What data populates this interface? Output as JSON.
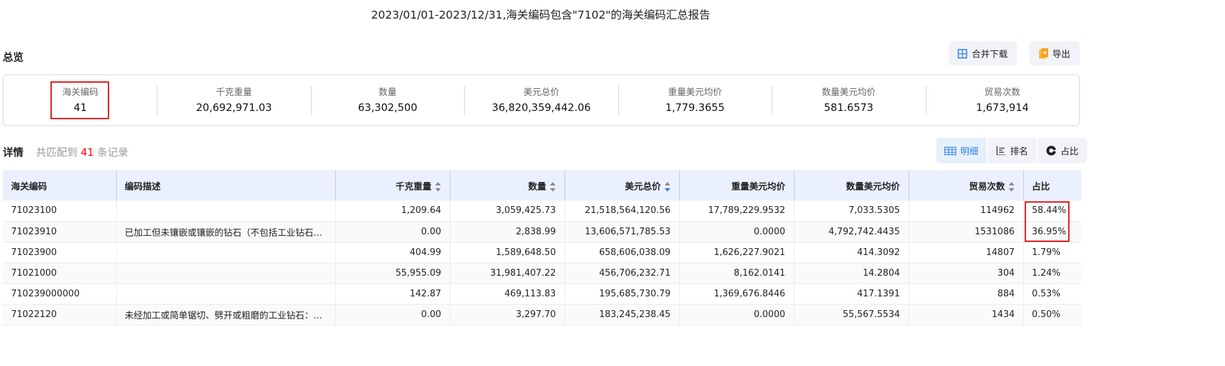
{
  "title": "2023/01/01-2023/12/31,海关编码包含\"7102\"的海关编码汇总报告",
  "overview": {
    "heading": "总览",
    "merge_download": "合并下载",
    "export": "导出",
    "stats": [
      {
        "label": "海关编码",
        "value": "41"
      },
      {
        "label": "千克重量",
        "value": "20,692,971.03"
      },
      {
        "label": "数量",
        "value": "63,302,500"
      },
      {
        "label": "美元总价",
        "value": "36,820,359,442.06"
      },
      {
        "label": "重量美元均价",
        "value": "1,779.3655"
      },
      {
        "label": "数量美元均价",
        "value": "581.6573"
      },
      {
        "label": "贸易次数",
        "value": "1,673,914"
      }
    ]
  },
  "details": {
    "heading": "详情",
    "summary_prefix": "共匹配到",
    "count": "41",
    "summary_suffix": "条记录",
    "tabs": [
      {
        "label": "明细",
        "active": true
      },
      {
        "label": "排名"
      },
      {
        "label": "占比"
      }
    ]
  },
  "accent": "#2b7de9",
  "table": {
    "columns": [
      "海关编码",
      "编码描述",
      "千克重量",
      "数量",
      "美元总价",
      "重量美元均价",
      "数量美元均价",
      "贸易次数",
      "占比"
    ],
    "sort": {
      "column": "美元总价",
      "direction": "desc"
    },
    "rows": [
      [
        "71023100",
        "",
        "1,209.64",
        "3,059,425.73",
        "21,518,564,120.56",
        "17,789,229.9532",
        "7,033.5305",
        "114962",
        "58.44%"
      ],
      [
        "71023910",
        "已加工但未镶嵌或镶嵌的钻石（不包括工业钻石…",
        "0.00",
        "2,838.99",
        "13,606,571,785.53",
        "0.0000",
        "4,792,742.4435",
        "1531086",
        "36.95%"
      ],
      [
        "71023900",
        "",
        "404.99",
        "1,589,648.50",
        "658,606,038.09",
        "1,626,227.9021",
        "414.3092",
        "14807",
        "1.79%"
      ],
      [
        "71021000",
        "",
        "55,955.09",
        "31,981,407.22",
        "456,706,232.71",
        "8,162.0141",
        "14.2804",
        "304",
        "1.24%"
      ],
      [
        "710239000000",
        "",
        "142.87",
        "469,113.83",
        "195,685,730.79",
        "1,369,676.8446",
        "417.1391",
        "884",
        "0.53%"
      ],
      [
        "71022120",
        "未经加工或简单锯切、劈开或粗磨的工业钻石：…",
        "0.00",
        "3,297.70",
        "183,245,238.45",
        "0.0000",
        "55,567.5534",
        "1434",
        "0.50%"
      ]
    ]
  }
}
